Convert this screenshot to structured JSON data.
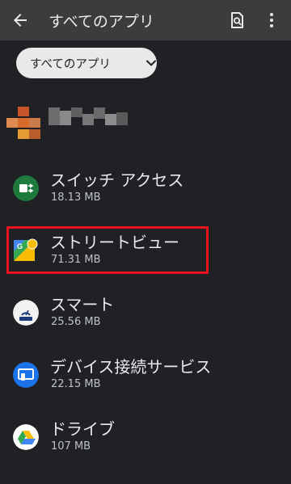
{
  "header": {
    "title": "すべてのアプリ"
  },
  "filter": {
    "selected": "すべてのアプリ"
  },
  "apps": [
    {
      "name": "スイッチ アクセス",
      "size": "18.13 MB",
      "icon": "switch-access-icon"
    },
    {
      "name": "ストリートビュー",
      "size": "71.31 MB",
      "icon": "street-view-icon"
    },
    {
      "name": "スマート",
      "size": "25.56 MB",
      "icon": "smart-icon"
    },
    {
      "name": "デバイス接続サービス",
      "size": "22.15 MB",
      "icon": "device-connect-icon"
    },
    {
      "name": "ドライブ",
      "size": "107 MB",
      "icon": "drive-icon"
    }
  ],
  "colors": {
    "appbar": "#3c3c3c",
    "background": "#202124",
    "chip": "#e9e9e9",
    "highlight": "#e8141c"
  }
}
